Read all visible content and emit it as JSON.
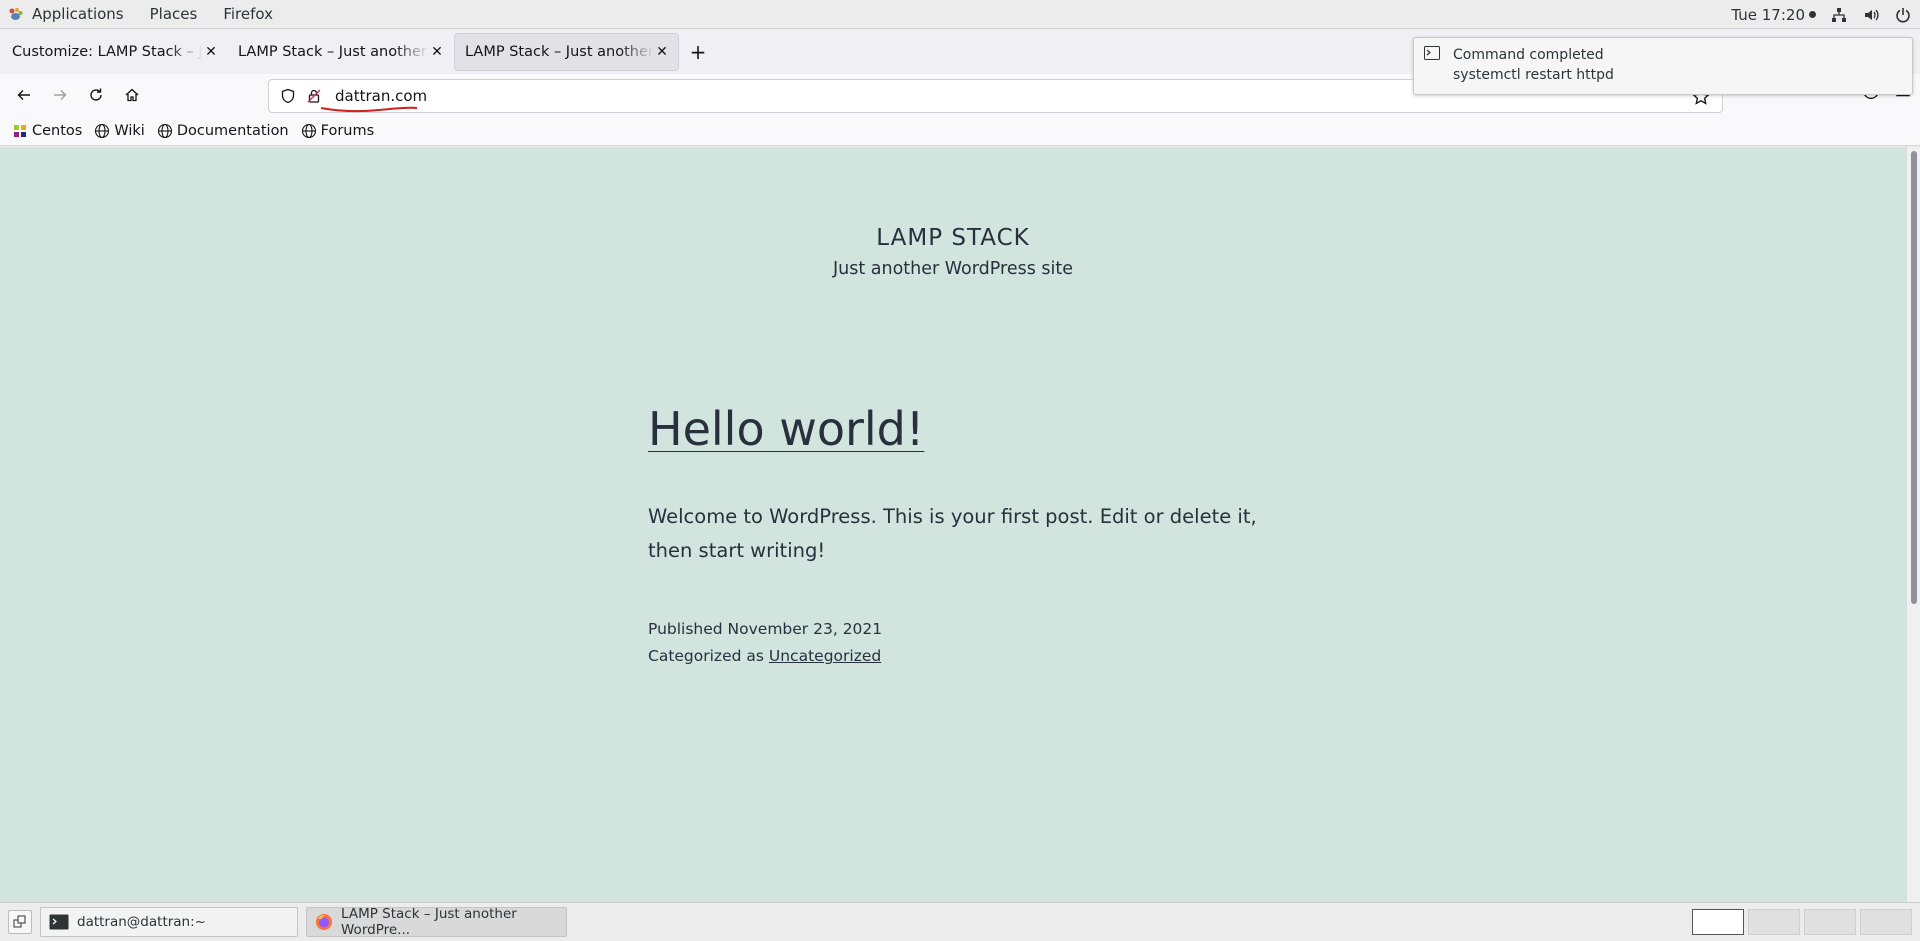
{
  "top_panel": {
    "menus": [
      "Applications",
      "Places",
      "Firefox"
    ],
    "clock": "Tue 17:20",
    "icons": [
      "network-icon",
      "volume-icon",
      "power-icon"
    ]
  },
  "browser": {
    "tabs": [
      {
        "title": "Customize: LAMP Stack – Just another WordPress site"
      },
      {
        "title": "LAMP Stack – Just another WordPress site"
      },
      {
        "title": "LAMP Stack – Just another WordPress site"
      }
    ],
    "url": "dattran.com",
    "bookmarks": [
      "Centos",
      "Wiki",
      "Documentation",
      "Forums"
    ]
  },
  "page": {
    "site_title": "LAMP STACK",
    "site_description": "Just another WordPress site",
    "post_title": "Hello world!",
    "post_content": "Welcome to WordPress. This is your first post. Edit or delete it, then start writing!",
    "published_label": "Published November 23, 2021",
    "categorized_label": "Categorized as",
    "category": "Uncategorized",
    "background_color": "#d1e4dd"
  },
  "notification": {
    "title": "Command completed",
    "body": "systemctl restart httpd"
  },
  "taskbar": {
    "tasks": [
      {
        "label": "dattran@dattran:~",
        "icon": "terminal-icon"
      },
      {
        "label": "LAMP Stack – Just another WordPre...",
        "icon": "firefox-icon"
      }
    ]
  }
}
